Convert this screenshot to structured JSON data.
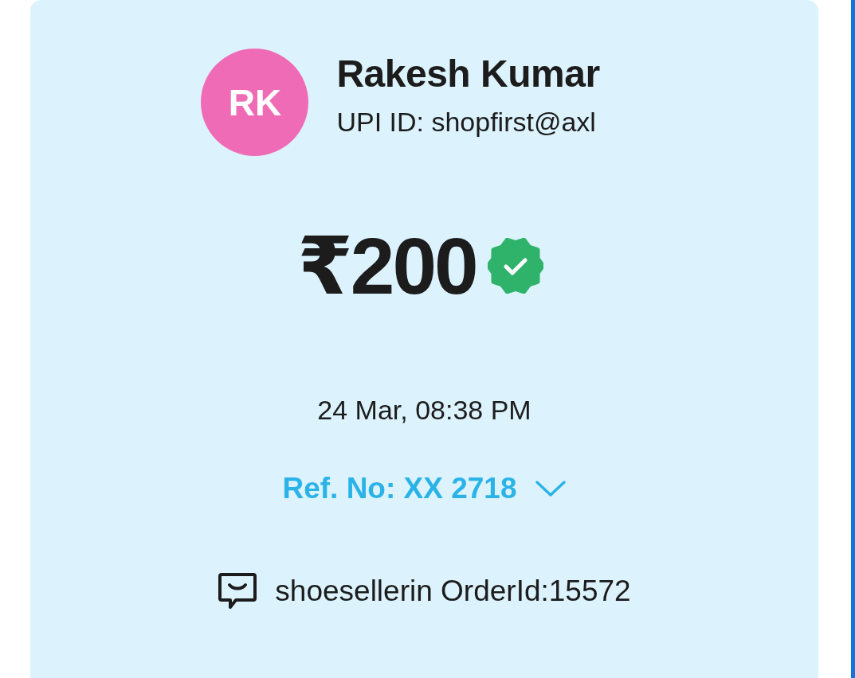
{
  "payee": {
    "initials": "RK",
    "color": "#f06bb5",
    "name": "Rakesh Kumar",
    "upi_id": "UPI ID: shopfirst@axl"
  },
  "payment": {
    "amount": "₹200",
    "verified": true,
    "datetime": "24 Mar, 08:38 PM",
    "reference": "Ref. No: XX 2718",
    "reference_expanded": false,
    "note": "shoesellerin OrderId:15572"
  }
}
